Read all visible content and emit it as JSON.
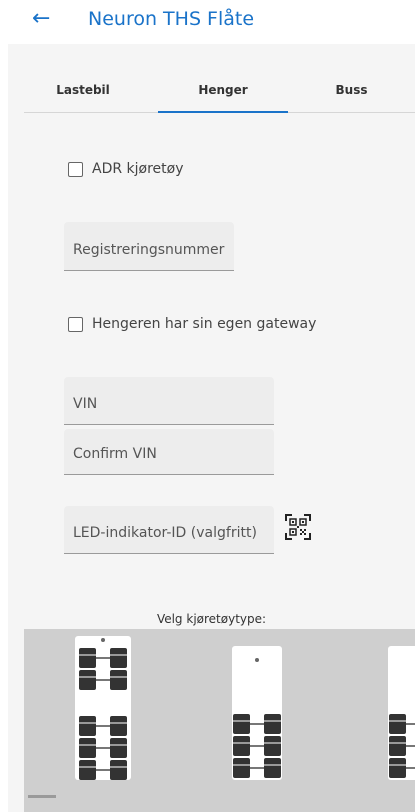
{
  "header": {
    "title": "Neuron THS Flåte",
    "back_icon": "arrow-left-icon"
  },
  "tabs": [
    {
      "label": "Lastebil",
      "active": false
    },
    {
      "label": "Henger",
      "active": true
    },
    {
      "label": "Buss",
      "active": false
    }
  ],
  "form": {
    "adr_label": "ADR kjøretøy",
    "adr_checked": false,
    "registration_label": "Registreringsnummer",
    "gateway_label": "Hengeren har sin egen gateway",
    "gateway_checked": false,
    "vin_label": "VIN",
    "confirm_vin_label": "Confirm VIN",
    "led_label": "LED-indikator-ID (valgfritt)",
    "qr_icon": "qr-code-scan-icon"
  },
  "vehicle_types": {
    "label": "Velg kjøretøytype:",
    "options": [
      {
        "name": "trailer-dolly-axles",
        "selected": false
      },
      {
        "name": "semi-trailer-three-axles",
        "selected": false
      },
      {
        "name": "trailer-partial",
        "selected": false
      }
    ]
  },
  "colors": {
    "accent": "#1a73c9",
    "field_bg": "#ededed",
    "panel_bg": "#f5f5f5",
    "gallery_bg": "#cfcfcf"
  }
}
